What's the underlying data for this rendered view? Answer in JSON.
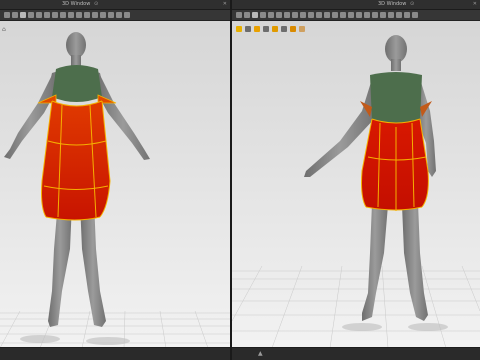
{
  "app": {
    "left_window": {
      "title": "3D Window"
    },
    "right_window": {
      "title": "3D Window"
    },
    "window_controls": {
      "pin": "⊙",
      "close": "✕"
    },
    "status": {
      "grip_glyph": "▲"
    },
    "viewport_corner_icon": "reset-view-icon"
  },
  "colors": {
    "viewport_bg_top": "#dcdcdc",
    "viewport_bg_bottom": "#f2f2f2",
    "garment_red": "#d41a00",
    "garment_seam": "#f5b000",
    "bodice_green": "#4d6e4c",
    "avatar_gray": "#8a8a8a"
  },
  "icons": {
    "toolbar": [
      "select-icon",
      "move-icon",
      "rotate-icon",
      "scale-icon",
      "pin-icon",
      "fold-icon",
      "tack-icon",
      "zoom-icon",
      "camera-icon",
      "light-icon",
      "display-icon",
      "settings-icon"
    ],
    "right_subtoolbar": [
      "sun-icon",
      "texture-icon",
      "camera-icon",
      "light-icon",
      "avatar-icon",
      "pose-icon",
      "paint-icon",
      "color-icon"
    ]
  }
}
